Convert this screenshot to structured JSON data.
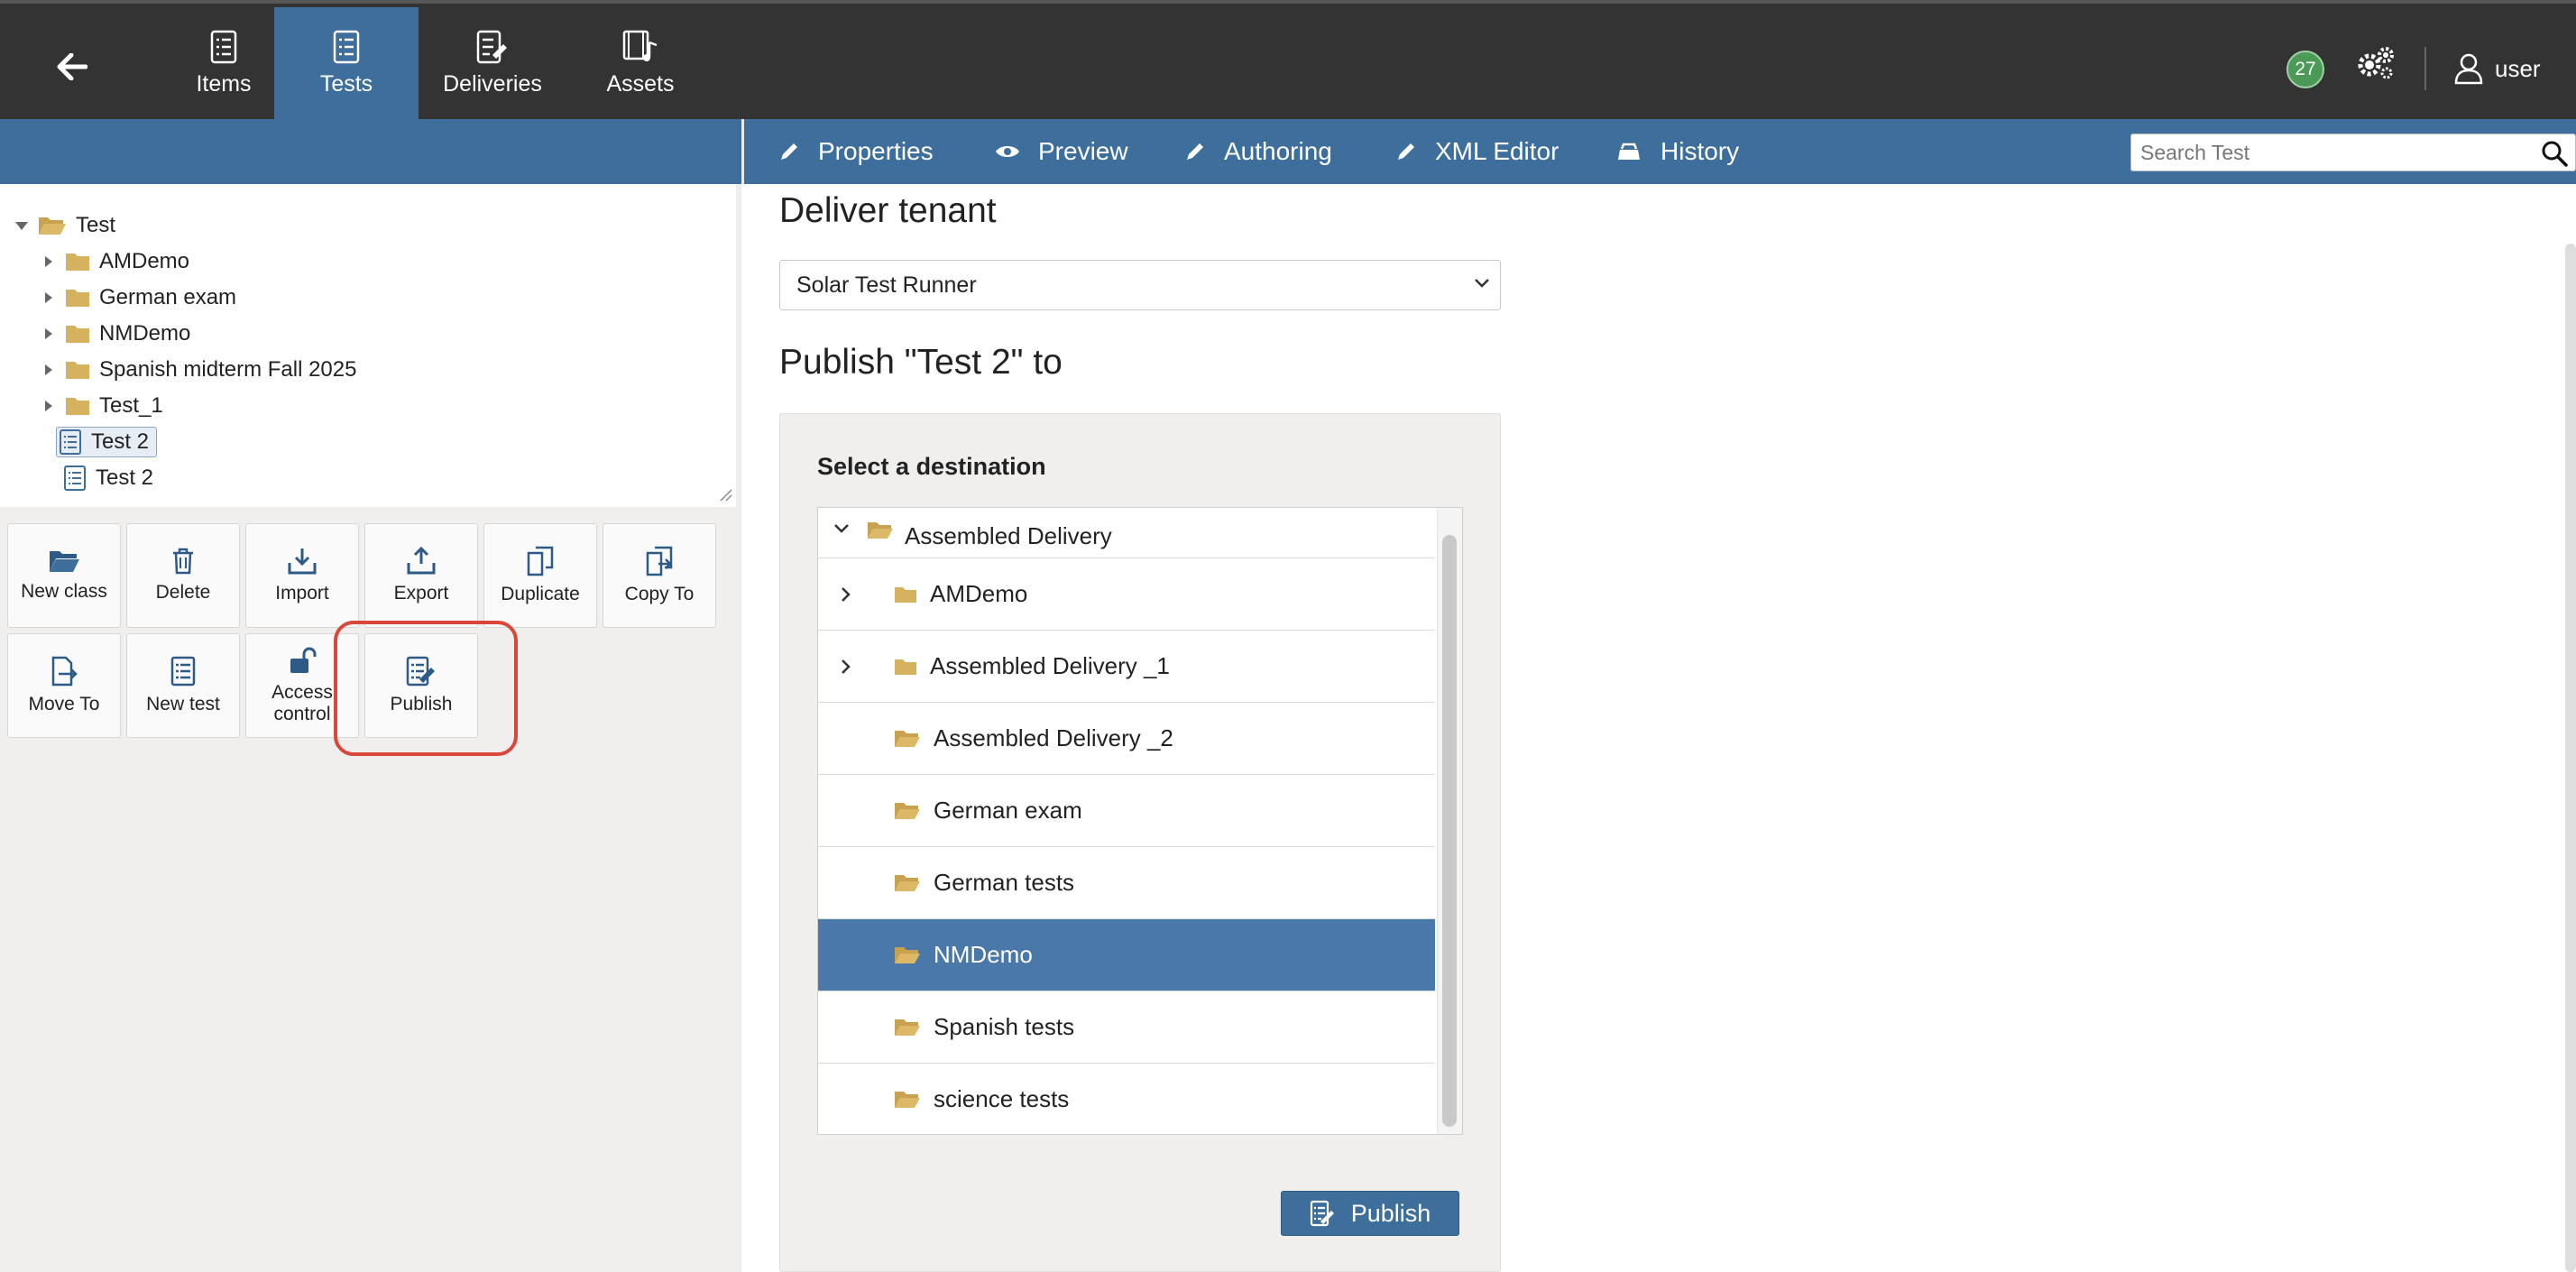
{
  "colors": {
    "topbar": "#333333",
    "accent_blue": "#3e6e9b",
    "selected_row": "#4a78a8",
    "badge_green": "#4c9a57",
    "folder": "#d4b25e",
    "highlight_ring": "#d9463a",
    "panel_gray": "#f0efee"
  },
  "topnav": {
    "back_icon": "arrow-left-icon",
    "tabs": [
      {
        "label": "Items",
        "icon": "items-list-icon",
        "active": false
      },
      {
        "label": "Tests",
        "icon": "tests-list-icon",
        "active": true
      },
      {
        "label": "Deliveries",
        "icon": "deliveries-icon",
        "active": false
      },
      {
        "label": "Assets",
        "icon": "assets-film-music-icon",
        "active": false
      }
    ],
    "notification_count": "27",
    "settings_icon": "gears-icon",
    "user_label": "user",
    "user_icon": "user-icon"
  },
  "action_tabs": [
    {
      "label": "Properties",
      "icon": "pencil-icon"
    },
    {
      "label": "Preview",
      "icon": "eye-icon"
    },
    {
      "label": "Authoring",
      "icon": "pencil-icon"
    },
    {
      "label": "XML Editor",
      "icon": "pencil-icon"
    },
    {
      "label": "History",
      "icon": "history-icon"
    }
  ],
  "search": {
    "placeholder": "Search Test",
    "icon": "search-icon"
  },
  "tree": {
    "root": "Test",
    "children": [
      {
        "label": "AMDemo",
        "type": "folder"
      },
      {
        "label": "German exam",
        "type": "folder"
      },
      {
        "label": "NMDemo",
        "type": "folder"
      },
      {
        "label": "Spanish midterm Fall 2025",
        "type": "folder"
      },
      {
        "label": "Test_1",
        "type": "folder"
      },
      {
        "label": "Test 2",
        "type": "test",
        "selected": true
      },
      {
        "label": "Test 2",
        "type": "test",
        "selected": false
      }
    ]
  },
  "action_buttons": [
    {
      "label": "New class",
      "icon": "folder-open-icon"
    },
    {
      "label": "Delete",
      "icon": "trash-icon"
    },
    {
      "label": "Import",
      "icon": "import-icon"
    },
    {
      "label": "Export",
      "icon": "export-icon"
    },
    {
      "label": "Duplicate",
      "icon": "duplicate-icon"
    },
    {
      "label": "Copy To",
      "icon": "copy-to-icon"
    },
    {
      "label": "Move To",
      "icon": "move-to-icon"
    },
    {
      "label": "New test",
      "icon": "new-test-icon"
    },
    {
      "label": "Access control",
      "icon": "unlock-icon"
    },
    {
      "label": "Publish",
      "icon": "publish-icon",
      "highlighted": true
    }
  ],
  "main": {
    "tenant_title": "Deliver tenant",
    "tenant_select_value": "Solar Test Runner",
    "publish_heading": "Publish \"Test 2\" to",
    "destination_label": "Select a destination",
    "destinations": [
      {
        "label": "Assembled Delivery",
        "expanded": true,
        "selected": false
      },
      {
        "label": "AMDemo",
        "expandable": true,
        "selected": false
      },
      {
        "label": "Assembled Delivery _1",
        "expandable": true,
        "selected": false
      },
      {
        "label": "Assembled Delivery _2",
        "expandable": false,
        "selected": false
      },
      {
        "label": "German exam",
        "expandable": false,
        "selected": false
      },
      {
        "label": "German tests",
        "expandable": false,
        "selected": false
      },
      {
        "label": "NMDemo",
        "expandable": false,
        "selected": true
      },
      {
        "label": "Spanish tests",
        "expandable": false,
        "selected": false
      },
      {
        "label": "science tests",
        "expandable": false,
        "selected": false
      }
    ],
    "publish_button": "Publish"
  }
}
